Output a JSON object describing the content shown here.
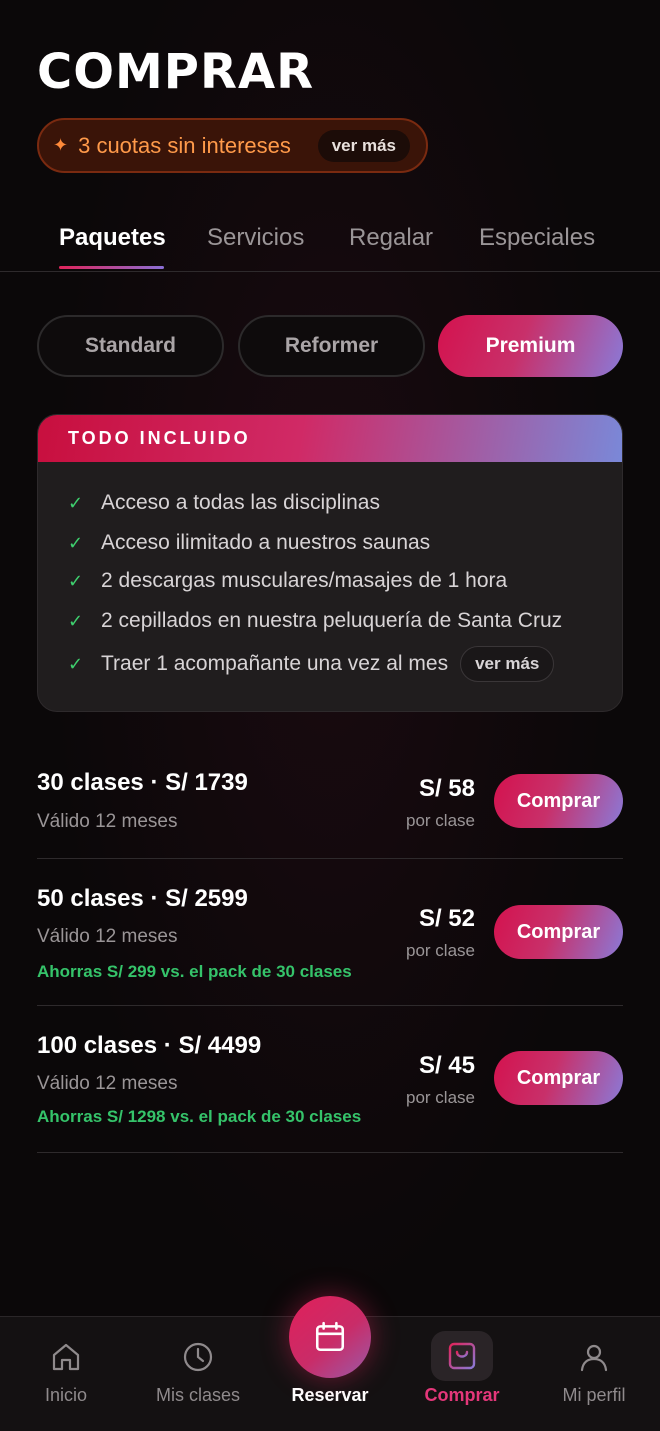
{
  "header": {
    "title": "COMPRAR"
  },
  "promo": {
    "text": "3 cuotas sin intereses",
    "more": "ver más"
  },
  "tabs": [
    {
      "label": "Paquetes",
      "active": true
    },
    {
      "label": "Servicios",
      "active": false
    },
    {
      "label": "Regalar",
      "active": false
    },
    {
      "label": "Especiales",
      "active": false
    }
  ],
  "segments": [
    {
      "label": "Standard",
      "active": false
    },
    {
      "label": "Reformer",
      "active": false
    },
    {
      "label": "Premium",
      "active": true
    }
  ],
  "included": {
    "title": "TODO INCLUIDO",
    "features": [
      "Acceso a todas las disciplinas",
      "Acceso ilimitado a nuestros saunas",
      "2 descargas musculares/masajes de 1 hora",
      "2 cepillados en nuestra peluquería de Santa Cruz",
      "Traer 1 acompañante una vez al mes"
    ],
    "more": "ver más"
  },
  "packages": [
    {
      "name": "30 clases · S/ 1739",
      "valid": "Válido 12 meses",
      "saving": "",
      "price": "S/ 58",
      "per": "por clase",
      "buy": "Comprar"
    },
    {
      "name": "50 clases · S/ 2599",
      "valid": "Válido 12 meses",
      "saving": "Ahorras S/ 299 vs. el pack de 30 clases",
      "price": "S/ 52",
      "per": "por clase",
      "buy": "Comprar"
    },
    {
      "name": "100 clases · S/ 4499",
      "valid": "Válido 12 meses",
      "saving": "Ahorras S/ 1298 vs. el pack de 30 clases",
      "price": "S/ 45",
      "per": "por clase",
      "buy": "Comprar"
    }
  ],
  "nav": [
    {
      "label": "Inicio",
      "icon": "home-icon"
    },
    {
      "label": "Mis clases",
      "icon": "clock-icon"
    },
    {
      "label": "Reservar",
      "icon": "calendar-icon"
    },
    {
      "label": "Comprar",
      "icon": "shopping-bag-icon",
      "selected": true
    },
    {
      "label": "Mi perfil",
      "icon": "user-icon"
    }
  ],
  "colors": {
    "accent": "#e0245a",
    "accent_end": "#8a7ad8",
    "promo_text": "#ff9a4a",
    "saving_green": "#35c36a",
    "check_green": "#3ecf6e"
  }
}
